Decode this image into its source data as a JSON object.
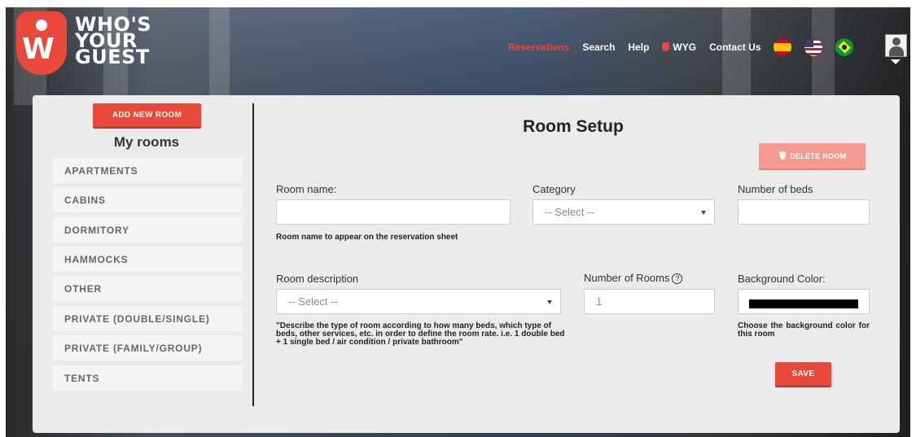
{
  "brand": {
    "logo_line1": "WHO'S",
    "logo_line2": "YOUR",
    "logo_line3": "GUEST",
    "accent_color": "#e8493a"
  },
  "nav": {
    "reservations": "Reservations",
    "search": "Search",
    "help": "Help",
    "wyg": "WYG",
    "contact": "Contact Us",
    "flags": [
      "spain-flag-icon",
      "usa-flag-icon",
      "brazil-flag-icon"
    ]
  },
  "sidebar": {
    "add_room_label": "ADD NEW ROOM",
    "heading": "My rooms",
    "items": [
      {
        "label": "APARTMENTS"
      },
      {
        "label": "CABINS"
      },
      {
        "label": "DORMITORY"
      },
      {
        "label": "HAMMOCKS"
      },
      {
        "label": "OTHER"
      },
      {
        "label": "PRIVATE (DOUBLE/SINGLE)"
      },
      {
        "label": "PRIVATE (FAMILY/GROUP)"
      },
      {
        "label": "TENTS"
      }
    ]
  },
  "form": {
    "title": "Room Setup",
    "delete_label": "DELETE ROOM",
    "room_name_label": "Room name:",
    "room_name_value": "",
    "room_name_hint": "Room name to appear on the reservation sheet",
    "category_label": "Category",
    "category_value": "-- Select --",
    "beds_label": "Number of beds",
    "beds_value": "",
    "description_label": "Room description",
    "description_value": "-- Select --",
    "description_hint": "\"Describe the type of room according to how many beds, which type of beds, other services, etc. in order to define the room rate. i.e. 1 double bed + 1 single bed / air condition / private bathroom\"",
    "rooms_label": "Number of Rooms",
    "rooms_help": "?",
    "rooms_value": "1",
    "color_label": "Background Color:",
    "color_value": "#000000",
    "color_hint": "Choose the background color for this room",
    "save_label": "SAVE"
  }
}
